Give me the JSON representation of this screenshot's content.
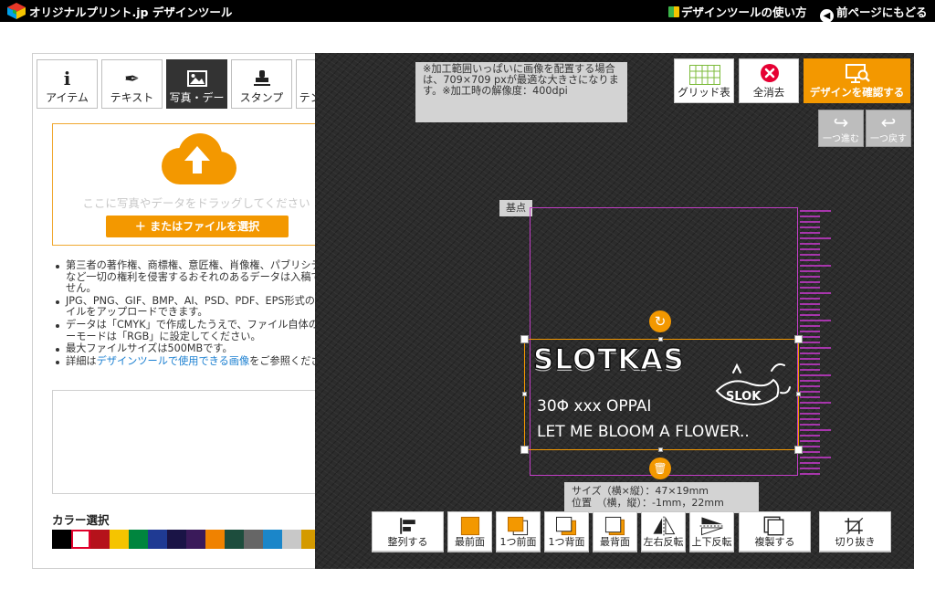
{
  "header": {
    "title": "オリジナルプリント.jp デザインツール",
    "help_link": "デザインツールの使い方",
    "back_link": "前ページにもどる"
  },
  "tabs": [
    {
      "label": "アイテム",
      "icon": "info-icon"
    },
    {
      "label": "テキスト",
      "icon": "pen-icon"
    },
    {
      "label": "写真・デー",
      "icon": "image-icon",
      "active": true
    },
    {
      "label": "スタンプ",
      "icon": "stamp-icon"
    },
    {
      "label": "テンプレー",
      "icon": "compass-icon"
    }
  ],
  "upload": {
    "drop_text": "ここに写真やデータをドラッグしてください",
    "select_button": "＋ またはファイルを選択",
    "notes": [
      "第三者の著作権、商標権、意匠権、肖像権、パブリシティ権など一切の権利を侵害するおそれのあるデータは入稿できません。",
      "JPG、PNG、GIF、BMP、AI、PSD、PDF、EPS形式のファイルをアップロードできます。",
      "データは「CMYK」で作成したうえで、ファイル自体のカラーモードは「RGB」に設定してください。",
      "最大ファイルサイズは500MBです。"
    ],
    "note_detail_prefix": "詳細は",
    "note_detail_link": "デザインツールで使用できる画像",
    "note_detail_suffix": "をご参照ください。"
  },
  "color_select": {
    "title": "カラー選択",
    "selected_index": 1,
    "swatches": [
      "#000000",
      "#ffffff",
      "#b5121b",
      "#f5c400",
      "#00853e",
      "#1f3a93",
      "#1a1446",
      "#3a1a5a",
      "#f08200",
      "#1d4d3d",
      "#666666",
      "#1b86c9",
      "#c8c8c8",
      "#d49a00",
      "#f08fc0"
    ]
  },
  "canvas": {
    "info_text": "※加工範囲いっぱいに画像を配置する場合は、709×709 pxが最適な大きさになります。※加工時の解像度：400dpi",
    "grid_button": "グリッド表",
    "clear_button": "全消去",
    "confirm_button": "デザインを確認する",
    "redo_button": "一つ進む",
    "undo_button": "一つ戻す",
    "origin_label": "基点",
    "size_text": "サイズ（横×縦）：47×19mm",
    "position_text": "位置　（横，縦）：-1mm，22mm"
  },
  "design": {
    "title": "SLOTKAS",
    "line1": "30Φ xxx OPPAI",
    "line2": "LET ME BLOOM A FLOWER.."
  },
  "toolbar": [
    {
      "label": "整列する",
      "icon": "align-icon"
    },
    {
      "label": "最前面",
      "icon": "bring-front-icon"
    },
    {
      "label": "1つ前面",
      "icon": "bring-forward-icon"
    },
    {
      "label": "1つ背面",
      "icon": "send-backward-icon"
    },
    {
      "label": "最背面",
      "icon": "send-back-icon"
    },
    {
      "label": "左右反転",
      "icon": "flip-horizontal-icon"
    },
    {
      "label": "上下反転",
      "icon": "flip-vertical-icon"
    },
    {
      "label": "複製する",
      "icon": "duplicate-icon"
    },
    {
      "label": "切り抜き",
      "icon": "crop-icon"
    }
  ]
}
